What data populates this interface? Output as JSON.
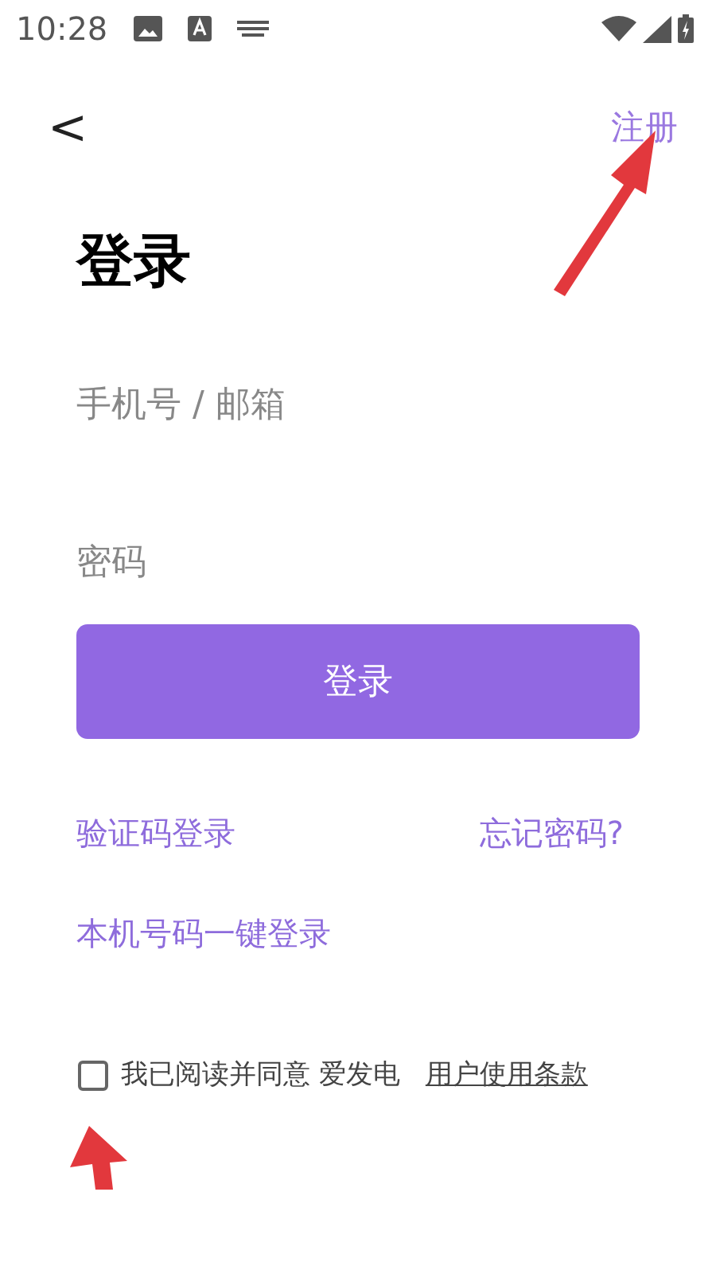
{
  "status_bar": {
    "time": "10:28"
  },
  "nav": {
    "back": "<",
    "action": "注册"
  },
  "title": "登录",
  "fields": [
    {
      "placeholder": "手机号 / 邮箱"
    },
    {
      "placeholder": "密码"
    }
  ],
  "submit": "登录",
  "links": [
    {
      "label": "验证码登录"
    },
    {
      "label": "忘记密码?"
    },
    {
      "label": "本机号码一键登录"
    }
  ],
  "agreement": {
    "checked": false,
    "text": "我已阅读并同意 爱发电",
    "link": "用户使用条款"
  }
}
